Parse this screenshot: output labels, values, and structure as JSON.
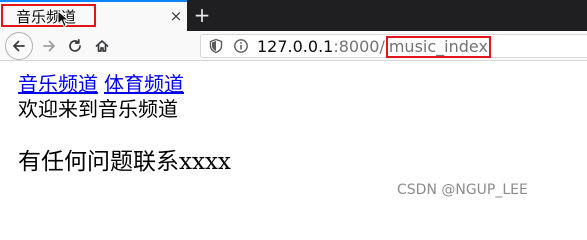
{
  "tab": {
    "title": "音乐频道",
    "close_glyph": "×",
    "new_tab_glyph": "+"
  },
  "urlbar": {
    "host": "127.0.0.1",
    "port": ":8000/",
    "path": "music_index"
  },
  "page": {
    "nav_links": [
      {
        "label": "音乐频道"
      },
      {
        "label": "体育频道"
      }
    ],
    "welcome": "欢迎来到音乐频道",
    "contact": "有任何问题联系xxxx"
  },
  "watermark": "CSDN @NGUP_LEE",
  "colors": {
    "highlight": "#e3141a",
    "link": "#0000ee",
    "tab_accent": "#0a84ff",
    "tabstrip_bg": "#1f1f22"
  }
}
